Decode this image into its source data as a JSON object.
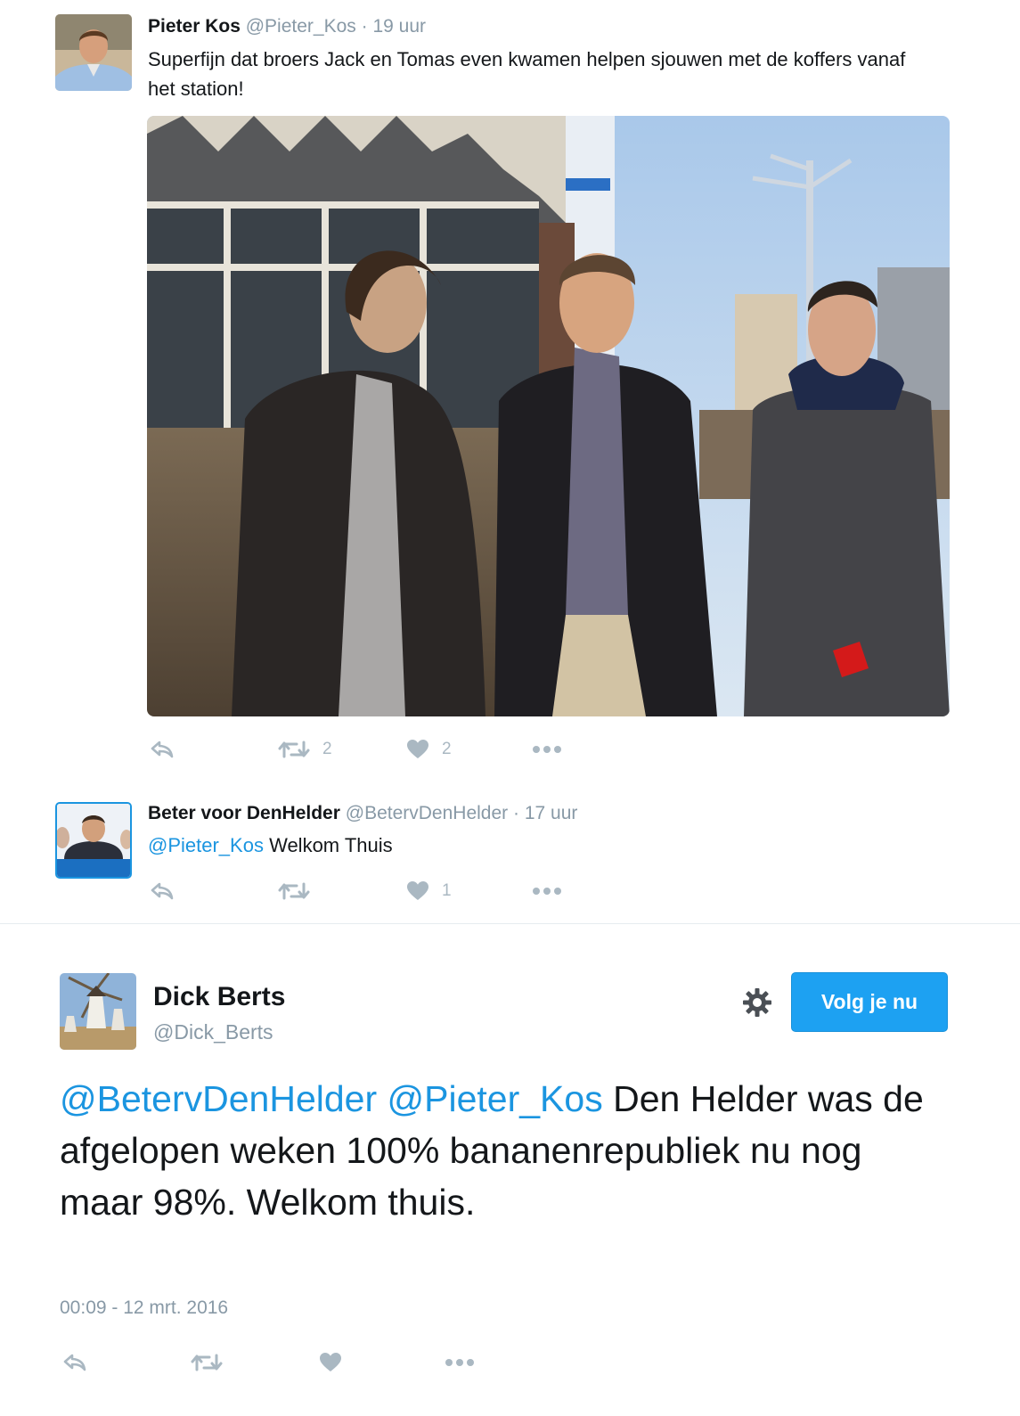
{
  "tweets": [
    {
      "name": "Pieter Kos",
      "handle": "@Pieter_Kos",
      "separator": "·",
      "time": "19 uur",
      "text": "Superfijn dat broers Jack en Tomas even kwamen helpen sjouwen met de koffers vanaf het station!",
      "photo_alt": "photo-three-men-station",
      "retweet_count": "2",
      "like_count": "2"
    },
    {
      "name": "Beter voor DenHelder",
      "handle": "@BetervDenHelder",
      "separator": "·",
      "time": "17 uur",
      "mention": "@Pieter_Kos",
      "text": "Welkom Thuis",
      "retweet_count": "",
      "like_count": "1"
    }
  ],
  "expanded": {
    "name": "Dick Berts",
    "handle": "@Dick_Berts",
    "follow_label": "Volg je nu",
    "mention1": "@BetervDenHelder",
    "mention2": "@Pieter_Kos",
    "text": "Den Helder was de afgelopen weken 100% bananenrepubliek nu nog maar 98%. Welkom thuis.",
    "timestamp": "00:09 - 12 mrt. 2016"
  },
  "icons": {
    "reply": "reply-icon",
    "retweet": "retweet-icon",
    "like": "heart-icon",
    "more": "more-icon",
    "settings": "gear-icon"
  },
  "colors": {
    "accent": "#1da1f2",
    "link": "#1b95e0",
    "muted": "#8899a6",
    "icon": "#aab8c2"
  }
}
